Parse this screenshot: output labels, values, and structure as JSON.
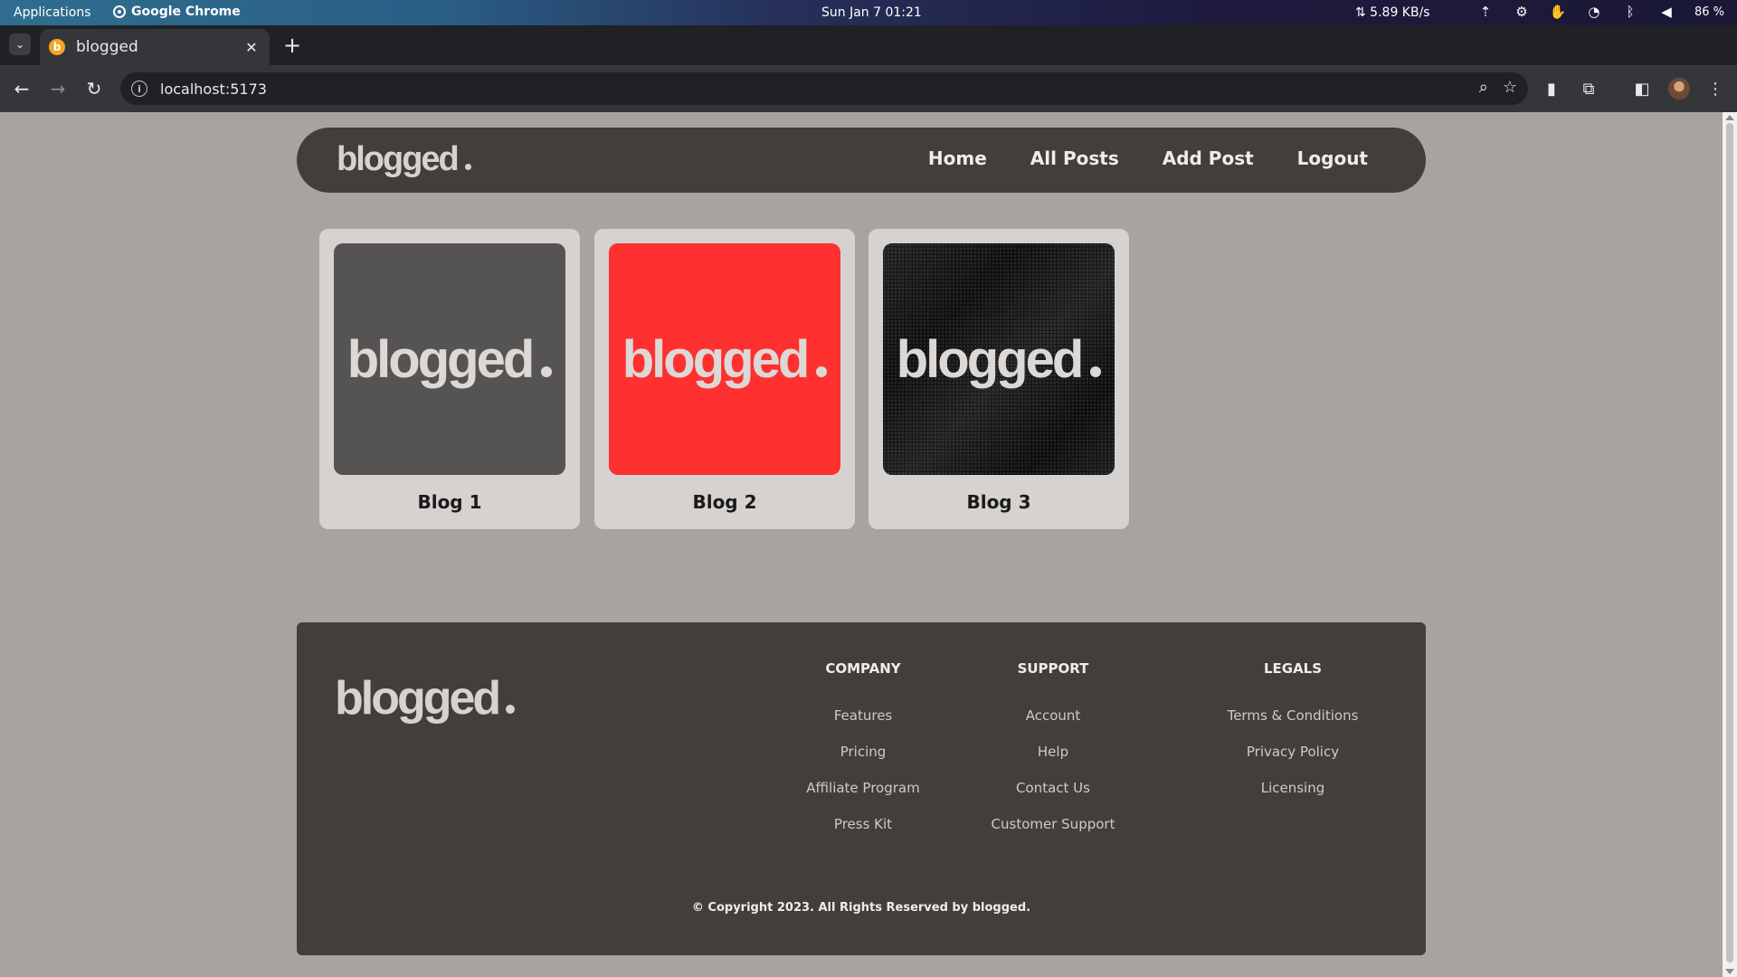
{
  "os": {
    "applications": "Applications",
    "active_app": "Google Chrome",
    "clock": "Sun Jan 7  01:21",
    "net_speed": "⇅ 5.89 KB/s",
    "battery": "86 %"
  },
  "browser": {
    "tab_title": "blogged",
    "tab_favicon": "b",
    "url": "localhost:5173"
  },
  "site": {
    "logo": "blogged",
    "nav": [
      "Home",
      "All Posts",
      "Add Post",
      "Logout"
    ],
    "posts": [
      {
        "title": "Blog 1",
        "thumb_color": "#565353"
      },
      {
        "title": "Blog 2",
        "thumb_color": "#ff3030"
      },
      {
        "title": "Blog 3",
        "thumb_color": "#1d1d1d"
      }
    ],
    "footer": {
      "columns": [
        {
          "heading": "COMPANY",
          "links": [
            "Features",
            "Pricing",
            "Affiliate Program",
            "Press Kit"
          ]
        },
        {
          "heading": "SUPPORT",
          "links": [
            "Account",
            "Help",
            "Contact Us",
            "Customer Support"
          ]
        },
        {
          "heading": "LEGALS",
          "links": [
            "Terms & Conditions",
            "Privacy Policy",
            "Licensing"
          ]
        }
      ],
      "copyright": "© Copyright 2023. All Rights Reserved by blogged."
    }
  },
  "colors": {
    "page_bg": "#a8a39f",
    "surface_dark": "#433e3a",
    "card_bg": "#d6d2cf"
  }
}
